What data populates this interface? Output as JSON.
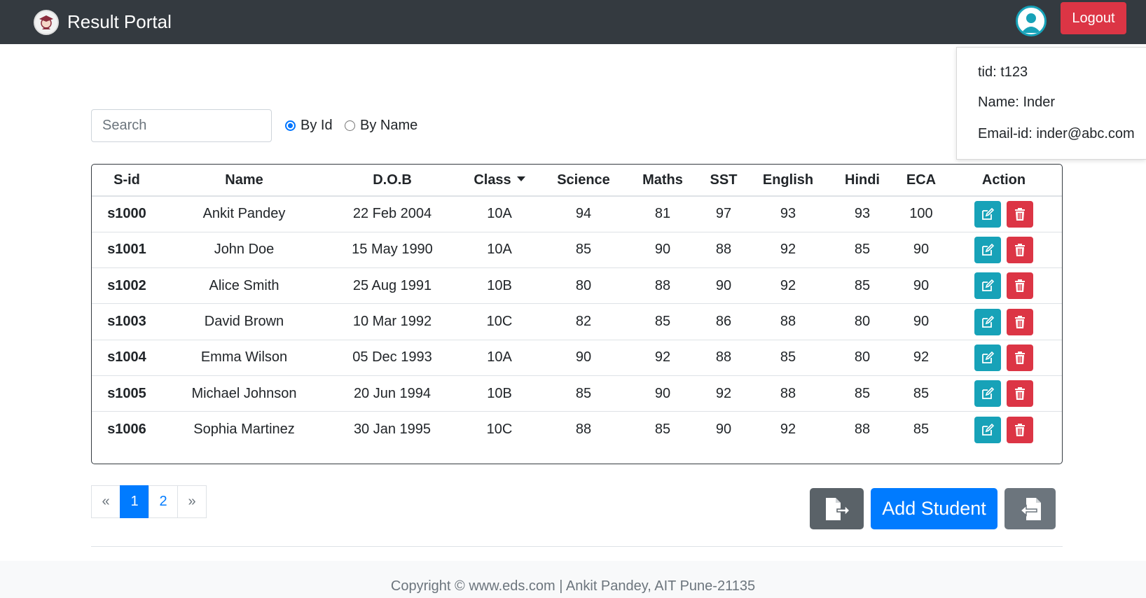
{
  "navbar": {
    "brand": "Result Portal",
    "logout_label": "Logout",
    "brand_icon": "graduate-logo-icon",
    "avatar_icon": "user-avatar-icon"
  },
  "user_dropdown": {
    "tid": "tid: t123",
    "name": "Name: Inder",
    "email": "Email-id: inder@abc.com"
  },
  "search": {
    "placeholder": "Search",
    "options": [
      {
        "label": "By Id",
        "checked": true
      },
      {
        "label": "By Name",
        "checked": false
      }
    ]
  },
  "table": {
    "headers": [
      "S-id",
      "Name",
      "D.O.B",
      "Class",
      "Science",
      "Maths",
      "SST",
      "English",
      "Hindi",
      "ECA",
      "Action"
    ],
    "rows": [
      [
        "s1000",
        "Ankit Pandey",
        "22 Feb 2004",
        "10A",
        "94",
        "81",
        "97",
        "93",
        "93",
        "100"
      ],
      [
        "s1001",
        "John Doe",
        "15 May 1990",
        "10A",
        "85",
        "90",
        "88",
        "92",
        "85",
        "90"
      ],
      [
        "s1002",
        "Alice Smith",
        "25 Aug 1991",
        "10B",
        "80",
        "88",
        "90",
        "92",
        "85",
        "90"
      ],
      [
        "s1003",
        "David Brown",
        "10 Mar 1992",
        "10C",
        "82",
        "85",
        "86",
        "88",
        "80",
        "90"
      ],
      [
        "s1004",
        "Emma Wilson",
        "05 Dec 1993",
        "10A",
        "90",
        "92",
        "88",
        "85",
        "80",
        "92"
      ],
      [
        "s1005",
        "Michael Johnson",
        "20 Jun 1994",
        "10B",
        "85",
        "90",
        "92",
        "88",
        "85",
        "85"
      ],
      [
        "s1006",
        "Sophia Martinez",
        "30 Jan 1995",
        "10C",
        "88",
        "85",
        "90",
        "92",
        "88",
        "85"
      ]
    ]
  },
  "pagination": {
    "prev": "«",
    "pages": [
      "1",
      "2"
    ],
    "next": "»",
    "active": "1"
  },
  "actions": {
    "add_student_label": "Add Student",
    "export_icon": "file-export-icon",
    "import_icon": "file-import-icon"
  },
  "footer": {
    "text": "Copyright © www.eds.com | Ankit Pandey, AIT Pune-21135"
  },
  "colors": {
    "navbar": "#343a40",
    "primary": "#007bff",
    "danger": "#dc3545",
    "info": "#17a2b8",
    "secondary": "#6c757d"
  }
}
